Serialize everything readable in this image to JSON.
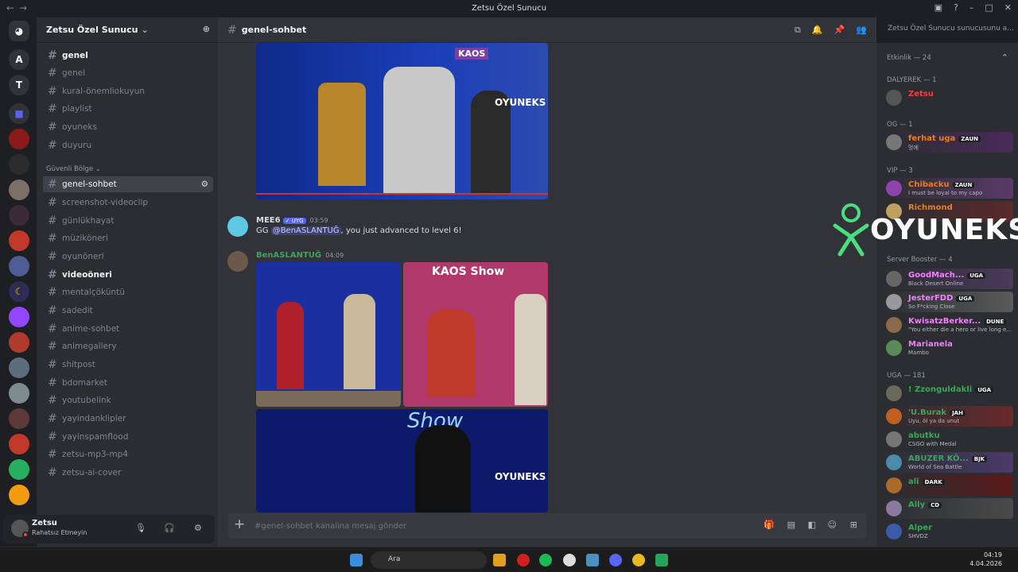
{
  "window": {
    "title": "Zetsu Özel Sunucu"
  },
  "guild_letters": [
    "A",
    "T"
  ],
  "server": {
    "name": "Zetsu Özel Sunucu"
  },
  "channels_top": [
    "genel",
    "genel",
    "kural-önemliokuyun",
    "playlist",
    "oyuneks",
    "duyuru"
  ],
  "category": "Güvenli Bölge",
  "channels_main": [
    "genel-sohbet",
    "screenshot-videoclip",
    "günlükhayat",
    "müziköneri",
    "oyunöneri",
    "videoöneri",
    "mentalçöküntü",
    "sadedit",
    "anime-sohbet",
    "animegallery",
    "shitpost",
    "bdomarket",
    "youtubelink",
    "yayindanklipler",
    "yayinspamflood",
    "zetsu-mp3-mp4",
    "zetsu-ai-cover"
  ],
  "user": {
    "name": "Zetsu",
    "status": "Rahatsız Etmeyin"
  },
  "chat": {
    "channel": "genel-sohbet",
    "composer_placeholder": "#genel-sohbet kanalina mesaj gönder",
    "messages": [
      {
        "author": "MEE6",
        "badge": "✓ UYG",
        "time": "03:59",
        "prefix": "GG ",
        "mention": "@BenASLANTUĞ",
        "suffix": ", you just advanced to level 6!"
      },
      {
        "author": "BenASLANTUĞ",
        "time": "04:09"
      }
    ],
    "embed_labels": [
      "KAOS",
      "OYUNEKS",
      "KAOS Show",
      "Show",
      "OYUNEKS"
    ]
  },
  "search": {
    "placeholder": "Zetsu Özel Sunucu sunucusunu a..."
  },
  "members": {
    "activity": "Etkinlik — 24",
    "groups": [
      "DALYEREK — 1",
      "OG — 1",
      "VIP — 3",
      "Server Booster — 4",
      "UGA — 181"
    ],
    "list": [
      {
        "name": "Zetsu",
        "color": "#ed4245"
      },
      {
        "name": "ferhat uga",
        "tag": "ZAUN",
        "status": "멍에",
        "color": "#e67e22"
      },
      {
        "name": "Chibacku",
        "tag": "ZAUN",
        "status": "I must be loyal to my capo",
        "color": "#e67e22"
      },
      {
        "name": "Richmond",
        "color": "#e67e22"
      },
      {
        "name": "GoodMach...",
        "tag": "UGA",
        "status": "Black Desert Online",
        "color": "#f47fff"
      },
      {
        "name": "JesterFDD",
        "tag": "UGA",
        "status": "So F*cking Close",
        "color": "#f47fff"
      },
      {
        "name": "KwisatzBerker...",
        "tag": "DUNE",
        "status": "\"You either die a hero or live long e...",
        "color": "#f47fff"
      },
      {
        "name": "Marianela",
        "status": "Mambo",
        "color": "#f47fff"
      },
      {
        "name": "! Zzonguldakli",
        "tag": "UGA",
        "color": "#3ba55c"
      },
      {
        "name": "'U.Burak",
        "tag": "JAH",
        "status": "Uyu, öl ya da unut",
        "color": "#3ba55c"
      },
      {
        "name": "abutku",
        "status": "CSGO with Medal",
        "color": "#3ba55c"
      },
      {
        "name": "ABUZER KÖ...",
        "tag": "BJK",
        "status": "World of Sea Battle",
        "color": "#3ba55c"
      },
      {
        "name": "ali",
        "tag": "DARK",
        "color": "#3ba55c"
      },
      {
        "name": "Ally",
        "tag": "CD",
        "color": "#3ba55c"
      },
      {
        "name": "Alper",
        "status": "SHVDZ",
        "color": "#3ba55c"
      }
    ]
  },
  "watermark": "OYUNEKS",
  "taskbar": {
    "search": "Ara",
    "time": "04:19",
    "date": "4.04.2026"
  }
}
